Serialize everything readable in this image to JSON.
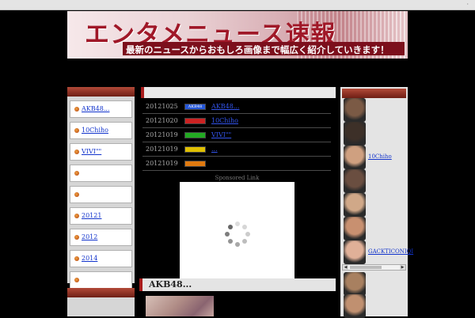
{
  "topbar": {
    "right_text": "·"
  },
  "banner": {
    "title": "エンタメニュース速報",
    "subtitle": "最新のニュースからおもしろ画像まで幅広く紹介していきます！"
  },
  "left_sidebar": {
    "items": [
      {
        "label": "AKB48..."
      },
      {
        "label": "10Chiho"
      },
      {
        "label": "VIVI\"\""
      },
      {
        "label": ""
      },
      {
        "label": ""
      },
      {
        "label": "20121"
      },
      {
        "label": "2012"
      },
      {
        "label": "2014"
      },
      {
        "label": ""
      },
      {
        "label": ""
      }
    ]
  },
  "news": [
    {
      "date": "20121025",
      "tag_text": "AKB48",
      "tag_color": "#2456d8",
      "title": "AKB48..."
    },
    {
      "date": "20121020",
      "tag_text": "",
      "tag_color": "#cc2222",
      "title": "10Chiho"
    },
    {
      "date": "20121019",
      "tag_text": "",
      "tag_color": "#22aa22",
      "title": "VIVI\"\""
    },
    {
      "date": "20121019",
      "tag_text": "",
      "tag_color": "#e0c000",
      "title": "..."
    },
    {
      "date": "20121019",
      "tag_text": "",
      "tag_color": "#e07a10",
      "title": ""
    }
  ],
  "sponsor_label": "Sponsored Link",
  "article": {
    "title": "AKB48..."
  },
  "right_sidebar": {
    "people": [
      {
        "name": "",
        "face_color": "#7b5a45"
      },
      {
        "name": "",
        "face_color": "#3d3028"
      },
      {
        "name": "10Chiho",
        "face_color": "#cfa080"
      },
      {
        "name": "",
        "face_color": "#6a4e40"
      },
      {
        "name": "",
        "face_color": "#d0a888"
      },
      {
        "name": "",
        "face_color": "#c89070"
      },
      {
        "name": "GACKTICONIQI",
        "face_color": "#e0b098"
      },
      {
        "name": "",
        "face_color": "#a88060"
      },
      {
        "name": "",
        "face_color": "#c09070"
      }
    ]
  },
  "colors": {
    "accent": "#a81c1c",
    "link": "#1133cc"
  }
}
